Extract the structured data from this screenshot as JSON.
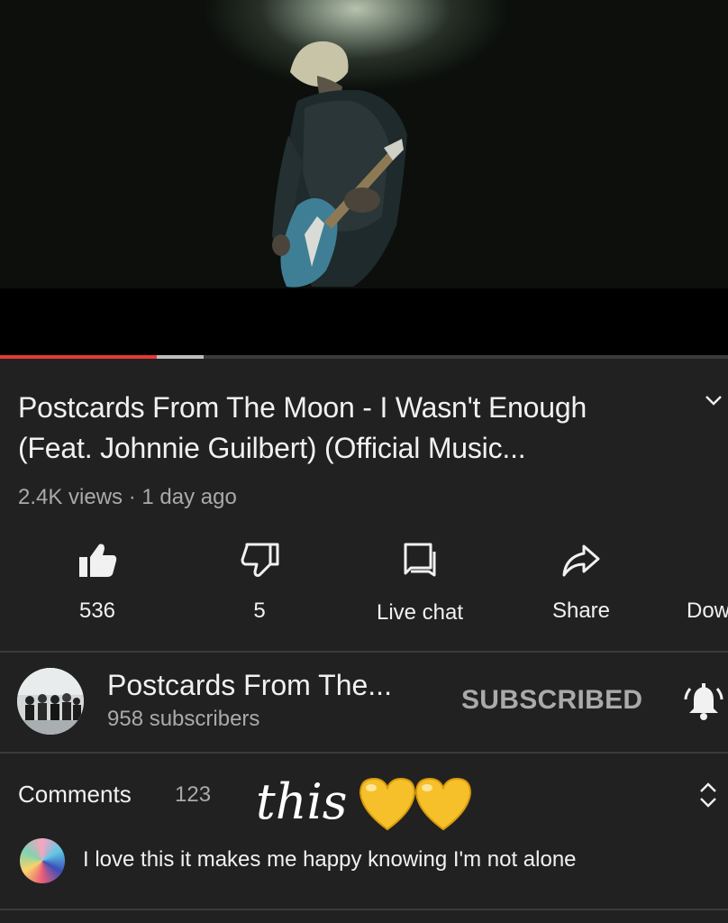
{
  "video": {
    "title": "Postcards From The Moon - I Wasn't Enough (Feat. Johnnie Guilbert) (Official Music...",
    "meta": "2.4K views · 1 day ago",
    "progress": {
      "played_fraction": 0.215,
      "buffered_fraction": 0.28
    }
  },
  "actions": {
    "like": {
      "label": "536",
      "icon": "thumbs-up-icon"
    },
    "dislike": {
      "label": "5",
      "icon": "thumbs-down-icon"
    },
    "live_chat": {
      "label": "Live chat",
      "icon": "chat-icon"
    },
    "share": {
      "label": "Share",
      "icon": "share-arrow-icon"
    },
    "download": {
      "label": "Dow",
      "icon": "download-icon"
    }
  },
  "channel": {
    "name": "Postcards From The...",
    "subscribers": "958 subscribers",
    "subscribe_label": "SUBSCRIBED"
  },
  "comments": {
    "label": "Comments",
    "count": "123",
    "annotation": "this",
    "first_comment": "I love this it makes me happy knowing I'm not alone"
  },
  "colors": {
    "background": "#212121",
    "progress_played": "#e53935",
    "progress_buffered": "#bdbdbd",
    "secondary_text": "#aaaaaa",
    "heart": "#f5c02a"
  }
}
